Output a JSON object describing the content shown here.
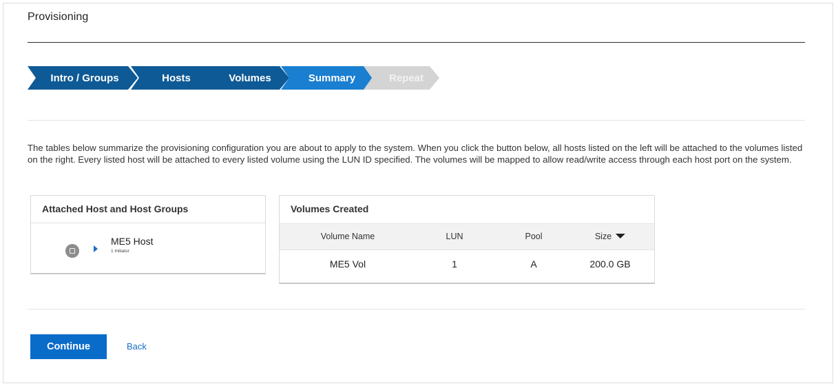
{
  "page": {
    "title": "Provisioning"
  },
  "wizard": {
    "steps": [
      {
        "label": "Intro / Groups",
        "state": "done"
      },
      {
        "label": "Hosts",
        "state": "done"
      },
      {
        "label": "Volumes",
        "state": "done"
      },
      {
        "label": "Summary",
        "state": "current"
      },
      {
        "label": "Repeat",
        "state": "upcoming"
      }
    ]
  },
  "intro": {
    "text": "The tables below summarize the provisioning configuration you are about to apply to the system. When you click the button below, all hosts listed on the left will be attached to the volumes listed on the right. Every listed host will be attached to every listed volume using the LUN ID specified. The volumes will be mapped to allow read/write access through each host port on the system."
  },
  "hosts_card": {
    "title": "Attached Host and Host Groups",
    "items": [
      {
        "name": "ME5 Host",
        "subtitle": "1 Initiator",
        "icon": "host-icon"
      }
    ]
  },
  "volumes_card": {
    "title": "Volumes Created",
    "columns": [
      "Volume Name",
      "LUN",
      "Pool",
      "Size"
    ],
    "sort_column": "Size",
    "sort_direction": "descending",
    "rows": [
      {
        "volume_name": "ME5 Vol",
        "lun": "1",
        "pool": "A",
        "size": "200.0 GB"
      }
    ]
  },
  "actions": {
    "continue_label": "Continue",
    "back_label": "Back"
  },
  "colors": {
    "step_done": "#0e5a96",
    "step_current": "#1a7fd0",
    "step_upcoming": "#d4d4d4",
    "primary_button": "#0a6cc9",
    "link": "#1a6fc4"
  }
}
